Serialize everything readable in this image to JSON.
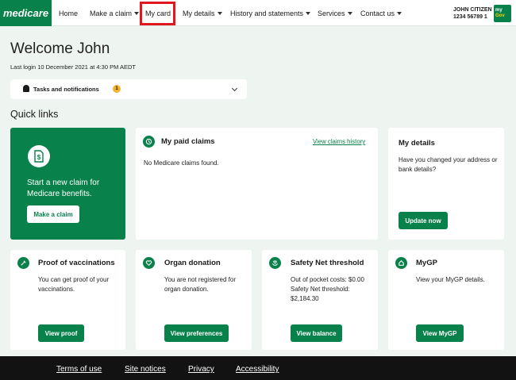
{
  "nav": {
    "logo": "medicare",
    "items": [
      {
        "label": "Home"
      },
      {
        "label": "Make a claim"
      },
      {
        "label": "My card"
      },
      {
        "label": "My details"
      },
      {
        "label": "History and statements"
      },
      {
        "label": "Services"
      },
      {
        "label": "Contact us"
      }
    ],
    "user_name": "JOHN CITIZEN",
    "user_number": "1234 56789 1",
    "mygov_line1": "my",
    "mygov_line2": "Gov"
  },
  "welcome": {
    "heading": "Welcome John",
    "last_login": "Last login 10 December 2021 at 4:30 PM AEDT"
  },
  "tasks": {
    "label": "Tasks and notifications",
    "count": "1"
  },
  "quick_links_heading": "Quick links",
  "cards": {
    "claim": {
      "text": "Start a new claim for Medicare benefits.",
      "button": "Make a claim"
    },
    "paid_claims": {
      "title": "My paid claims",
      "link": "View claims history",
      "text": "No Medicare claims found."
    },
    "details": {
      "title": "My details",
      "text": "Have you changed your address or bank details?",
      "button": "Update now"
    },
    "vaccinations": {
      "title": "Proof of vaccinations",
      "text": "You can get proof of your vaccinations.",
      "button": "View proof"
    },
    "organ": {
      "title": "Organ donation",
      "text": "You are not registered for organ donation.",
      "button": "View preferences"
    },
    "safety_net": {
      "title": "Safety Net threshold",
      "line1": "Out of pocket costs: $0.00",
      "line2": "Safety Net threshold:",
      "line3": "$2,184.30",
      "button": "View balance"
    },
    "mygp": {
      "title": "MyGP",
      "text": "View your MyGP details.",
      "button": "View MyGP"
    }
  },
  "footer": {
    "links": [
      {
        "label": "Terms of use"
      },
      {
        "label": "Site notices"
      },
      {
        "label": "Privacy"
      },
      {
        "label": "Accessibility"
      }
    ]
  }
}
